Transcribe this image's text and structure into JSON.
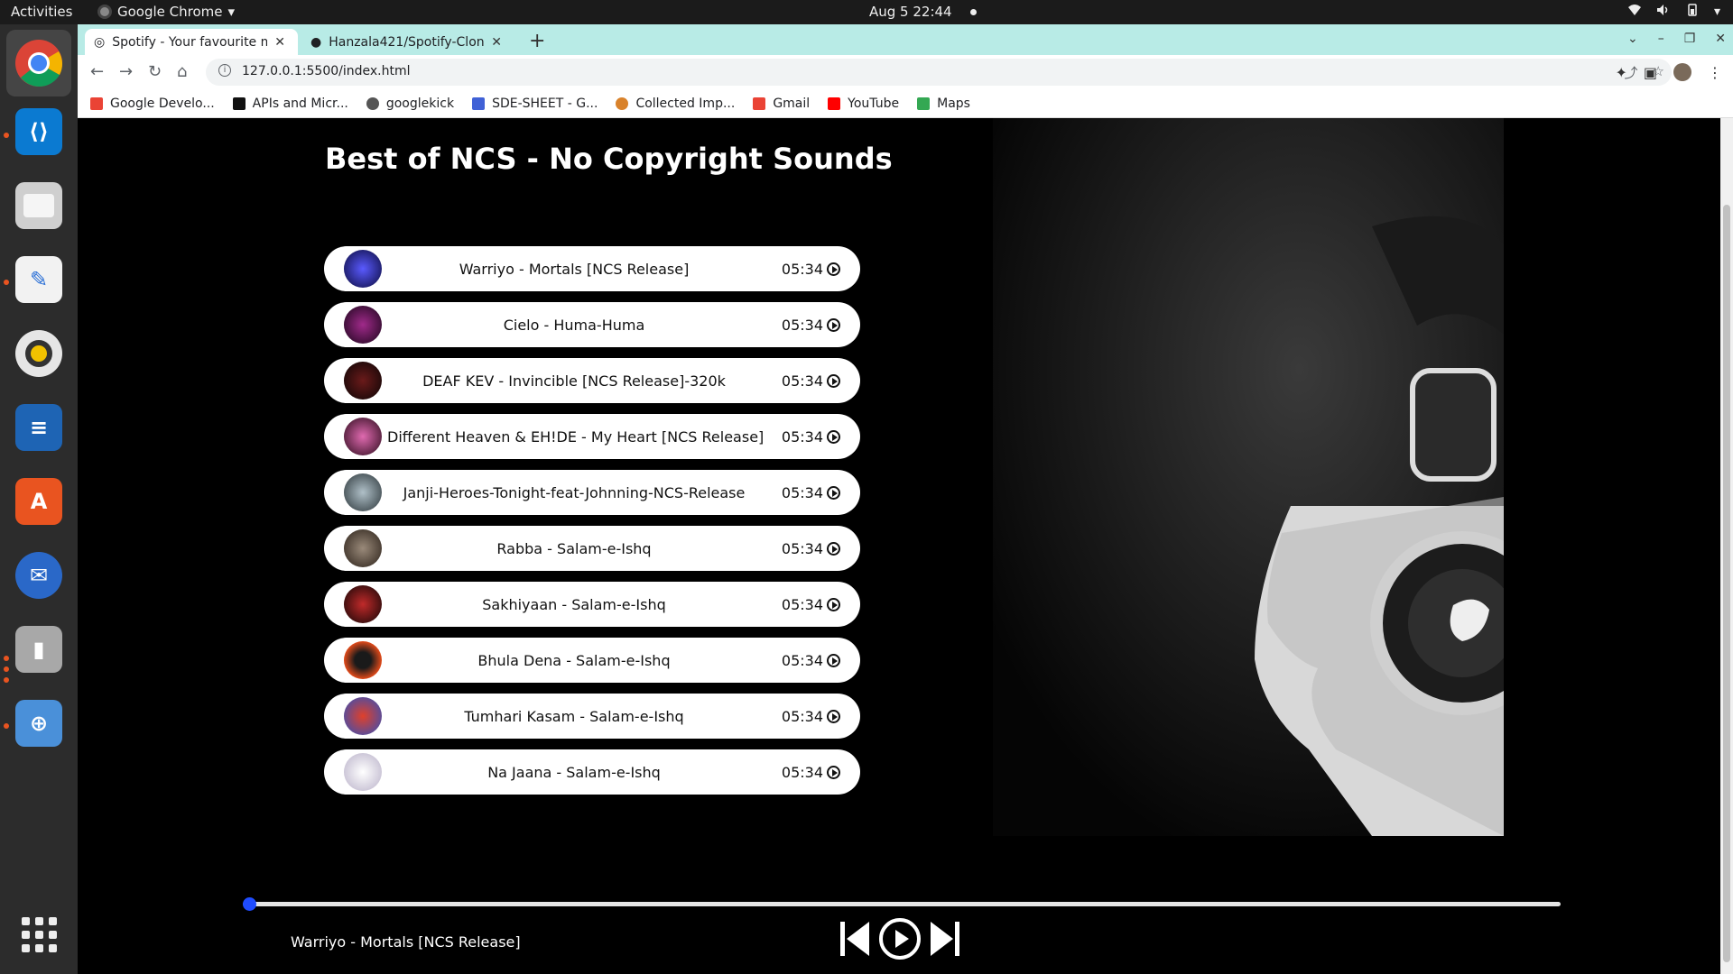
{
  "system": {
    "activities": "Activities",
    "app_menu": "Google Chrome",
    "clock": "Aug 5  22:44"
  },
  "browser": {
    "tabs": [
      {
        "title": "Spotify - Your favourite m",
        "active": true
      },
      {
        "title": "Hanzala421/Spotify-Clone",
        "active": false
      }
    ],
    "url": "127.0.0.1:5500/index.html",
    "bookmarks": [
      {
        "label": "Google Develo...",
        "color": "#ea4335"
      },
      {
        "label": "APIs and Micr...",
        "color": "#111111"
      },
      {
        "label": "googlekick",
        "color": "#555555"
      },
      {
        "label": "SDE-SHEET - G...",
        "color": "#4061d6"
      },
      {
        "label": "Collected Imp...",
        "color": "#d9822b"
      },
      {
        "label": "Gmail",
        "color": "#ea4335"
      },
      {
        "label": "YouTube",
        "color": "#ff0000"
      },
      {
        "label": "Maps",
        "color": "#34a853"
      }
    ]
  },
  "playlist": {
    "title": "Best of NCS - No Copyright Sounds",
    "songs": [
      {
        "name": "Warriyo - Mortals [NCS Release]",
        "duration": "05:34",
        "color": "#2a2a8c"
      },
      {
        "name": "Cielo - Huma-Huma",
        "duration": "05:34",
        "color": "#3a0d3a"
      },
      {
        "name": "DEAF KEV - Invincible [NCS Release]-320k",
        "duration": "05:34",
        "color": "#1a0a0a"
      },
      {
        "name": "Different Heaven & EH!DE - My Heart [NCS Release]",
        "duration": "05:34",
        "color": "#5a2a4a"
      },
      {
        "name": "Janji-Heroes-Tonight-feat-Johnning-NCS-Release",
        "duration": "05:34",
        "color": "#6a7a80"
      },
      {
        "name": "Rabba - Salam-e-Ishq",
        "duration": "05:34",
        "color": "#5a4a40"
      },
      {
        "name": "Sakhiyaan - Salam-e-Ishq",
        "duration": "05:34",
        "color": "#2a0a0a"
      },
      {
        "name": "Bhula Dena - Salam-e-Ishq",
        "duration": "05:34",
        "color": "#d0401a"
      },
      {
        "name": "Tumhari Kasam - Salam-e-Ishq",
        "duration": "05:34",
        "color": "#b02a2a"
      },
      {
        "name": "Na Jaana - Salam-e-Ishq",
        "duration": "05:34",
        "color": "#c8c0d0"
      }
    ]
  },
  "player": {
    "now_playing": "Warriyo - Mortals [NCS Release]",
    "progress_percent": 0,
    "accent": "#1f4cff"
  }
}
